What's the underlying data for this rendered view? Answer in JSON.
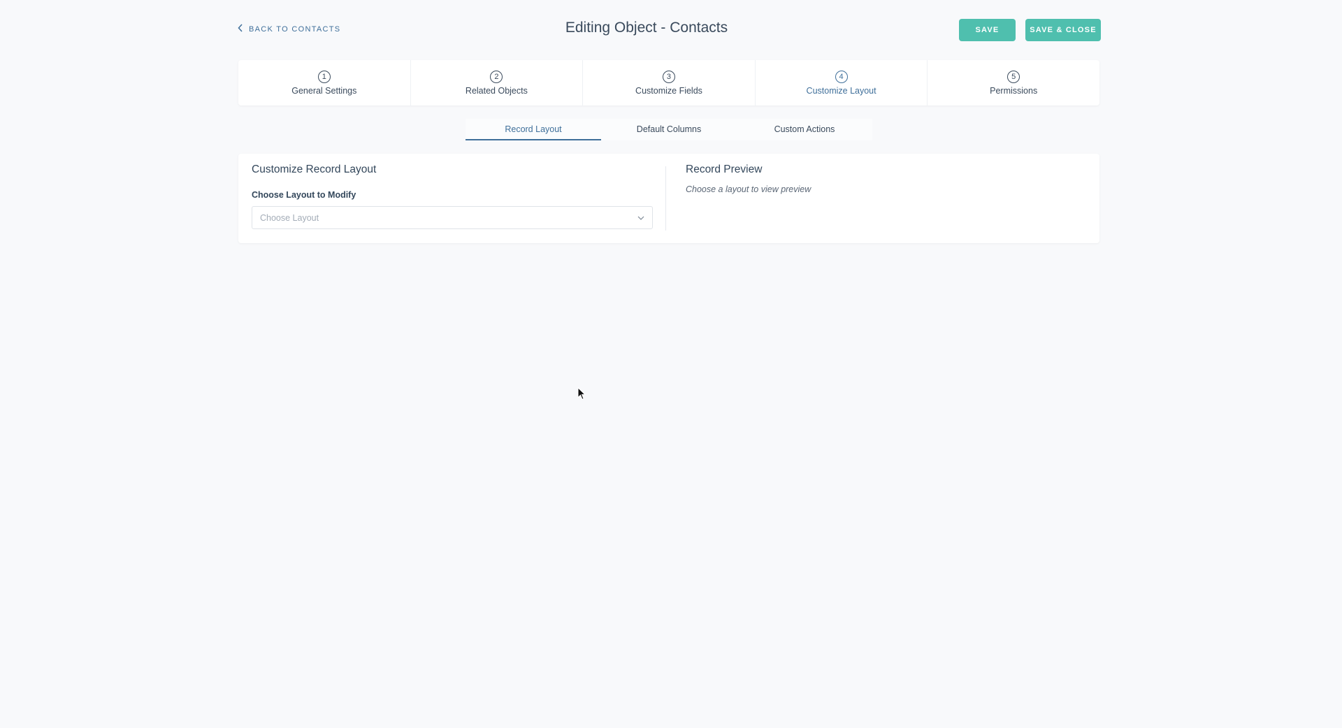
{
  "header": {
    "back_label": "BACK TO CONTACTS",
    "title": "Editing Object - Contacts",
    "save_label": "SAVE",
    "save_close_label": "SAVE & CLOSE"
  },
  "steps": [
    {
      "num": "1",
      "label": "General Settings"
    },
    {
      "num": "2",
      "label": "Related Objects"
    },
    {
      "num": "3",
      "label": "Customize Fields"
    },
    {
      "num": "4",
      "label": "Customize Layout",
      "active": true
    },
    {
      "num": "5",
      "label": "Permissions"
    }
  ],
  "subtabs": [
    {
      "label": "Record Layout",
      "active": true
    },
    {
      "label": "Default Columns"
    },
    {
      "label": "Custom Actions"
    }
  ],
  "layout_panel": {
    "title": "Customize Record Layout",
    "field_label": "Choose Layout to Modify",
    "select_placeholder": "Choose Layout"
  },
  "preview_panel": {
    "title": "Record Preview",
    "hint": "Choose a layout to view preview"
  },
  "colors": {
    "accent": "#3f6f9a",
    "button": "#4fbfae",
    "background": "#f8f9fb"
  },
  "icons": {
    "back": "chevron-left-icon",
    "select": "chevron-down-icon",
    "pointer": "mouse-cursor-icon"
  }
}
